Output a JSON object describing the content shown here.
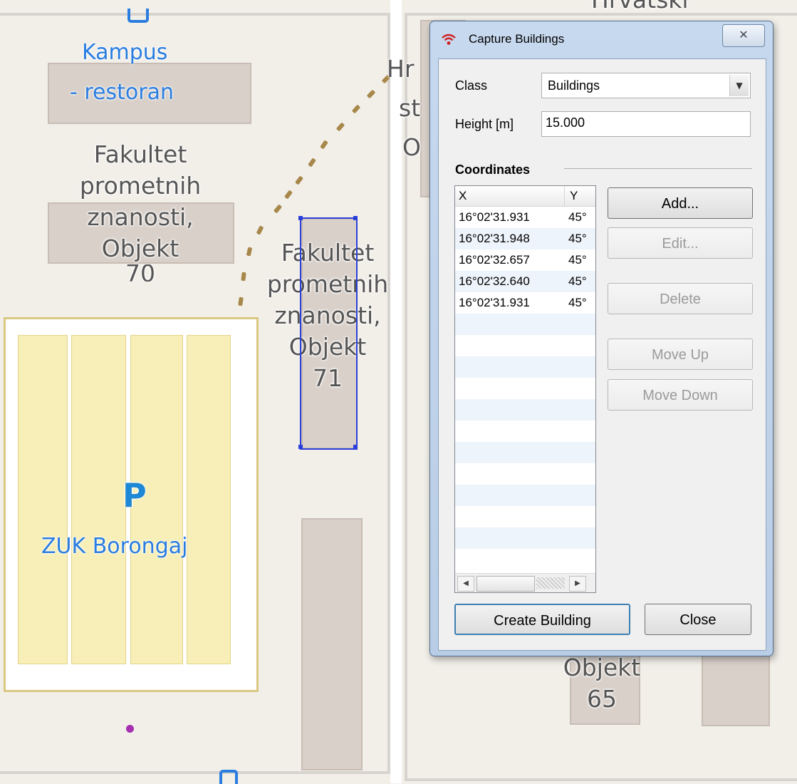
{
  "map": {
    "labels": {
      "kampus_line1": "Kampus",
      "kampus_line2": "- restoran",
      "fpz70": [
        "Fakultet",
        "prometnih",
        "znanosti,",
        "Objekt",
        "70"
      ],
      "fpz71": [
        "Fakultet",
        "prometnih",
        "znanosti,",
        "Objekt",
        "71"
      ],
      "hrvatski_top": "Hrvatski",
      "hr_partial": [
        "Hr",
        "st",
        "O"
      ],
      "objekt65": [
        "Objekt",
        "65"
      ],
      "parking_symbol": "P",
      "zuk": "ZUK Borongaj"
    },
    "colors": {
      "background": "#f2efe9",
      "building": "#d9d0c9",
      "parking": "#f7efb7",
      "selection": "#2b3fd9",
      "poi_blue": "#2a7de0"
    }
  },
  "dialog": {
    "title": "Capture Buildings",
    "title_icon": "wifi-signal-icon",
    "close_glyph": "✕",
    "class_label": "Class",
    "class_value": "Buildings",
    "height_label": "Height [m]",
    "height_value": "15.000",
    "coords_heading": "Coordinates",
    "columns": [
      "X",
      "Y"
    ],
    "rows": [
      {
        "x": "16°02'31.931",
        "y": "45°"
      },
      {
        "x": "16°02'31.948",
        "y": "45°"
      },
      {
        "x": "16°02'32.657",
        "y": "45°"
      },
      {
        "x": "16°02'32.640",
        "y": "45°"
      },
      {
        "x": "16°02'31.931",
        "y": "45°"
      }
    ],
    "buttons": {
      "add": "Add...",
      "edit": "Edit...",
      "delete": "Delete",
      "move_up": "Move Up",
      "move_down": "Move Down",
      "create": "Create Building",
      "close": "Close"
    }
  }
}
